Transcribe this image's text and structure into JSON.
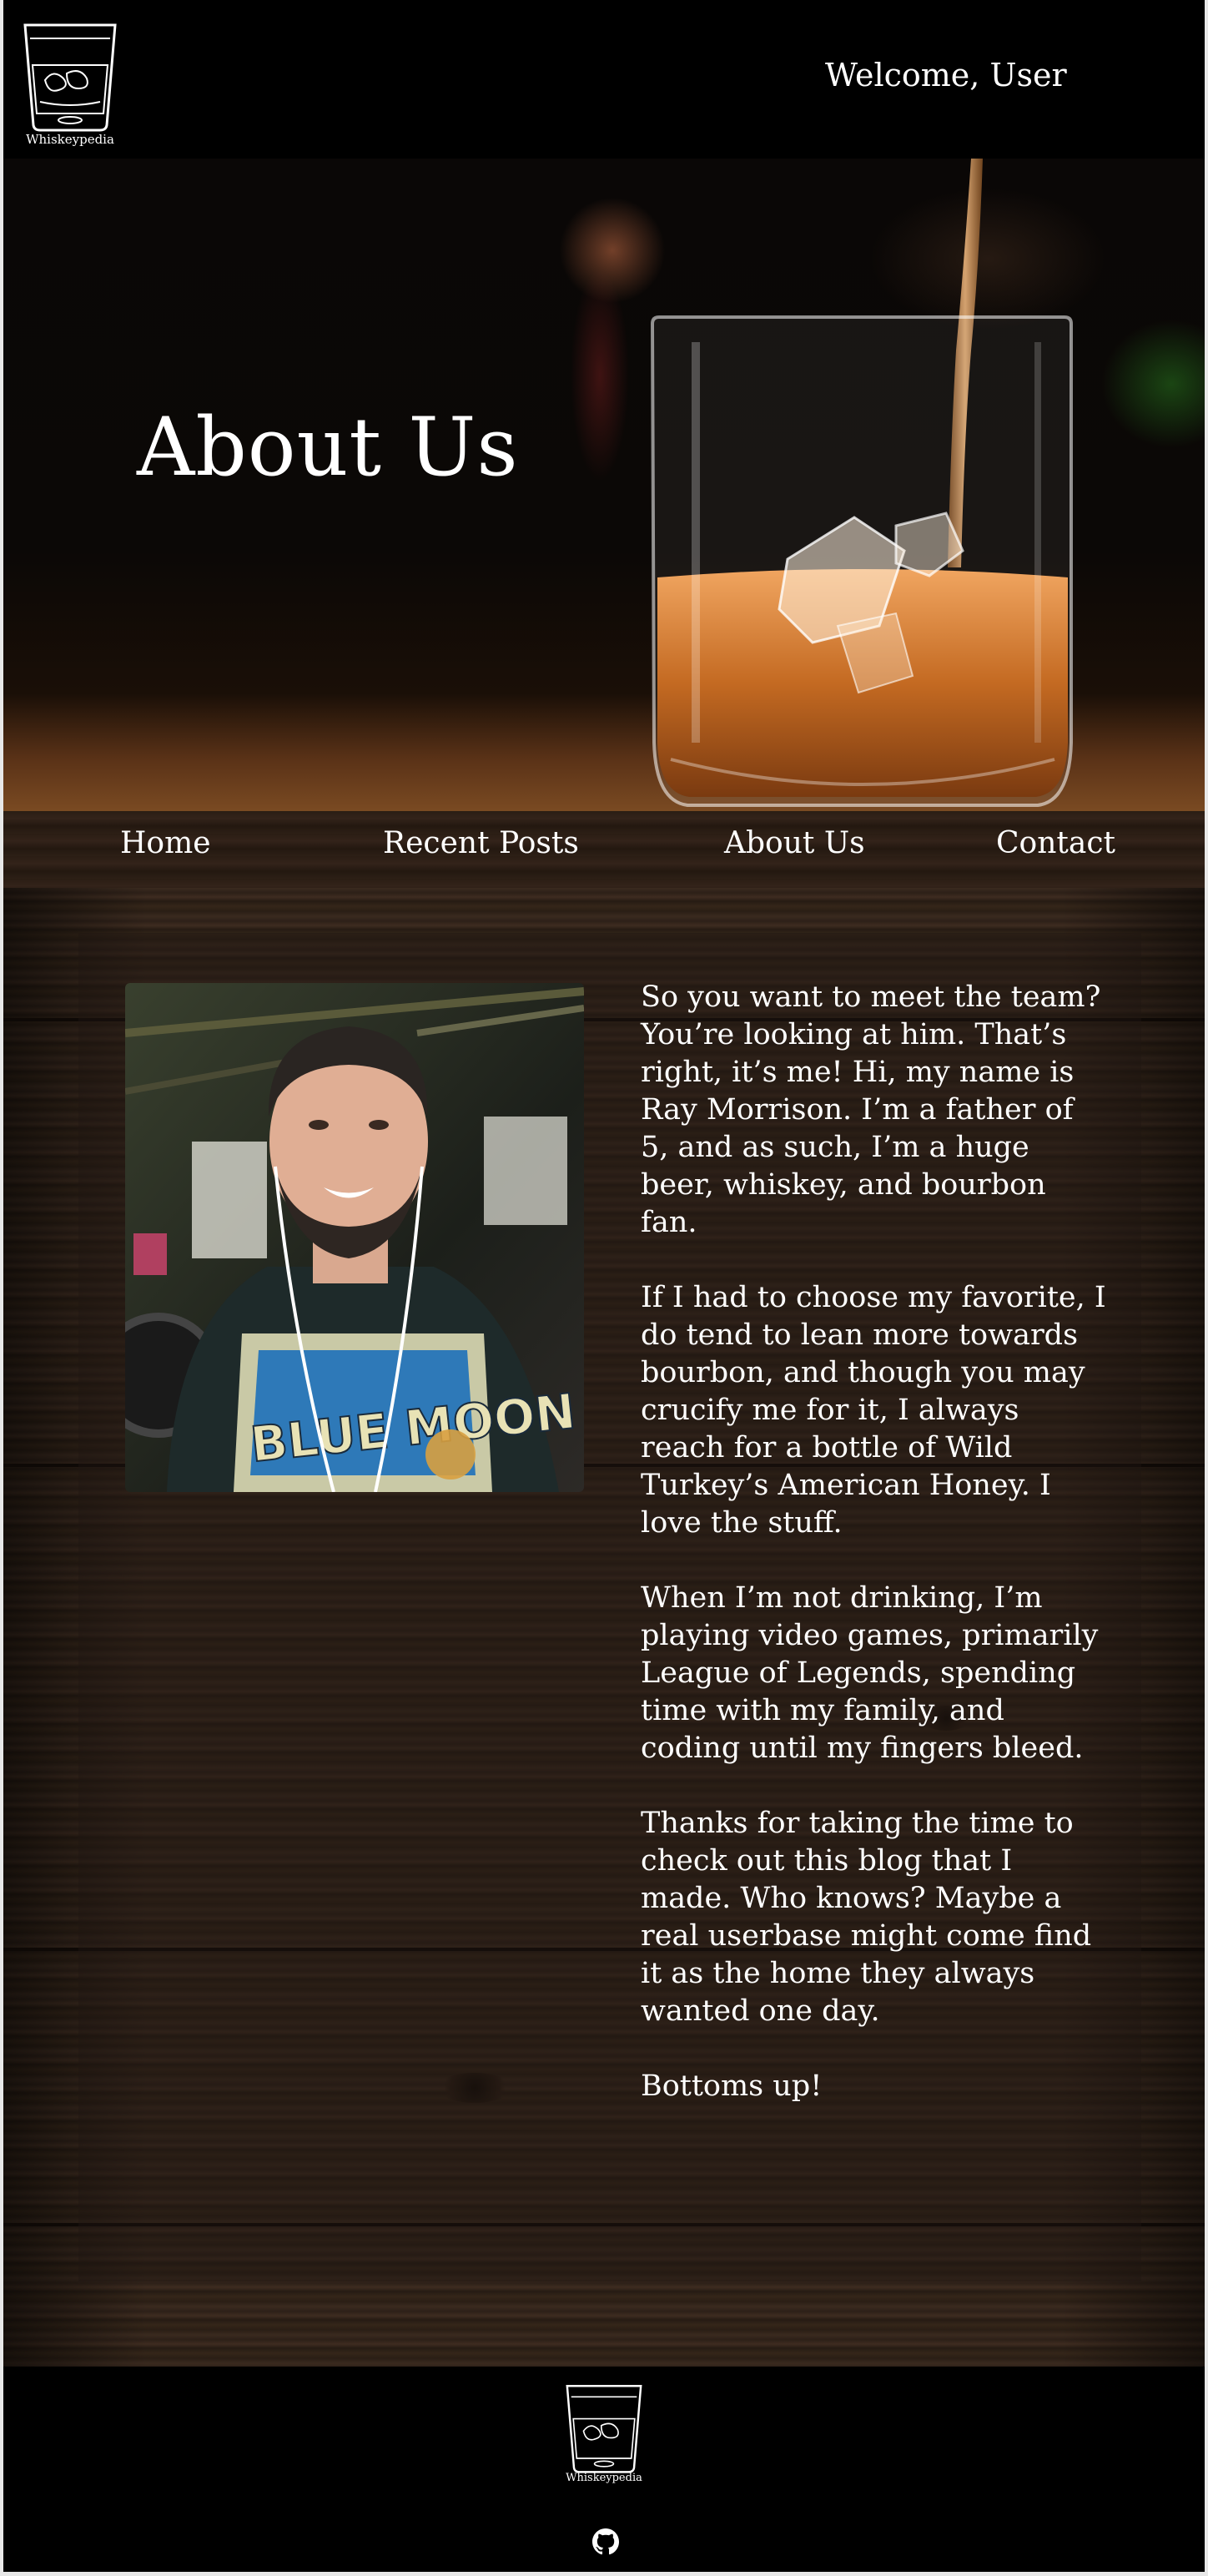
{
  "header": {
    "logo_text": "Whiskeypedia",
    "welcome": "Welcome, User"
  },
  "hero": {
    "title": "About Us"
  },
  "nav": {
    "items": [
      {
        "label": "Home"
      },
      {
        "label": "Recent Posts"
      },
      {
        "label": "About Us"
      },
      {
        "label": "Contact"
      }
    ]
  },
  "about": {
    "paragraphs": [
      "So you want to meet the team? You’re looking at him. That’s right, it’s me! Hi, my name is Ray Morrison. I’m a father of 5, and as such, I’m a huge beer, whiskey, and bourbon fan.",
      "If I had to choose my favorite, I do tend to lean more towards bourbon, and though you may crucify me for it, I always reach for a bottle of Wild Turkey’s American Honey. I love the stuff.",
      "When I’m not drinking, I’m playing video games, primarily League of Legends, spending time with my family, and coding until my fingers bleed.",
      "Thanks for taking the time to check out this blog that I made. Who knows? Maybe a real userbase might come find it as the home they always wanted one day.",
      "Bottoms up!"
    ],
    "photo_shirt_text": "BLUE MOON"
  },
  "footer": {
    "logo_text": "Whiskeypedia",
    "github_icon": "github-icon"
  },
  "colors": {
    "background": "#000000",
    "text": "#ffffff",
    "wood": "#3a2a1f"
  }
}
